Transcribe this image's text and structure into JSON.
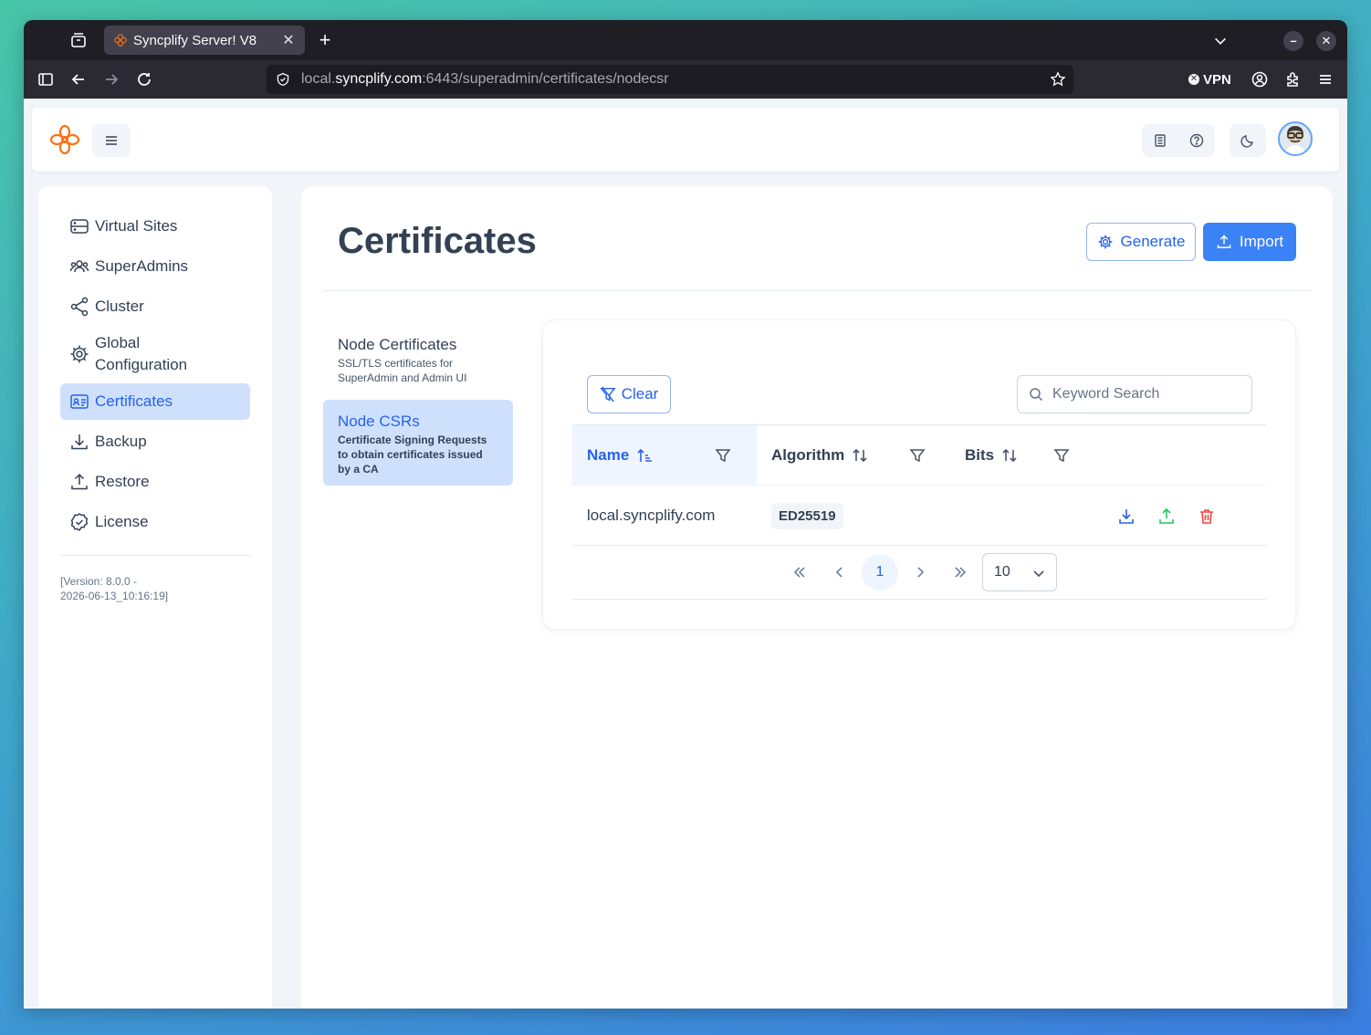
{
  "browser": {
    "tab_title": "Syncplify Server! V8",
    "url_host_prefix": "local.",
    "url_host": "syncplify.com",
    "url_rest": ":6443/superadmin/certificates/nodecsr",
    "vpn_label": "VPN"
  },
  "sidebar": {
    "items": [
      {
        "label": "Virtual Sites",
        "icon": "server-icon"
      },
      {
        "label": "SuperAdmins",
        "icon": "users-icon"
      },
      {
        "label": "Cluster",
        "icon": "share-icon"
      },
      {
        "label": "Global Configuration",
        "icon": "gear-icon"
      },
      {
        "label": "Certificates",
        "icon": "id-card-icon",
        "active": true
      },
      {
        "label": "Backup",
        "icon": "download-icon"
      },
      {
        "label": "Restore",
        "icon": "upload-icon"
      },
      {
        "label": "License",
        "icon": "check-circle-icon"
      }
    ],
    "version_line1": "[Version: 8.0.0 -",
    "version_line2": "2026-06-13_10:16:19]"
  },
  "main": {
    "title": "Certificates",
    "generate_label": "Generate",
    "import_label": "Import",
    "subnav": [
      {
        "title": "Node Certificates",
        "desc": "SSL/TLS certificates for SuperAdmin and Admin UI"
      },
      {
        "title": "Node CSRs",
        "desc": "Certificate Signing Requests to obtain certificates issued by a CA",
        "active": true
      }
    ]
  },
  "table": {
    "clear_label": "Clear",
    "search_placeholder": "Keyword Search",
    "columns": [
      "Name",
      "Algorithm",
      "Bits"
    ],
    "rows": [
      {
        "name": "local.syncplify.com",
        "algorithm": "ED25519",
        "bits": ""
      }
    ],
    "current_page": "1",
    "rows_per_page": "10"
  },
  "colors": {
    "accent": "#3b82f6",
    "active_bg": "#cfe0fc",
    "download": "#2563eb",
    "upload": "#22c55e",
    "delete": "#ef4444",
    "logo": "#f97316"
  }
}
